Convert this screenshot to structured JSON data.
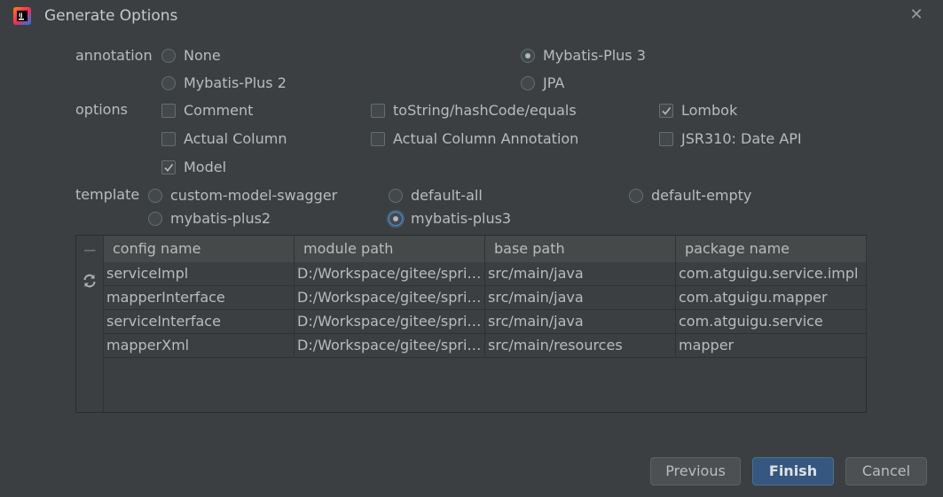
{
  "window": {
    "title": "Generate Options",
    "app_icon": "intellij-icon",
    "close_icon": "close-icon"
  },
  "annotation": {
    "label": "annotation",
    "options": [
      "None",
      "Mybatis-Plus 3",
      "Mybatis-Plus 2",
      "JPA"
    ],
    "selected": "Mybatis-Plus 3"
  },
  "options": {
    "label": "options",
    "items": [
      {
        "label": "Comment",
        "checked": false
      },
      {
        "label": "toString/hashCode/equals",
        "checked": false
      },
      {
        "label": "Lombok",
        "checked": true
      },
      {
        "label": "Actual Column",
        "checked": false
      },
      {
        "label": "Actual Column Annotation",
        "checked": false
      },
      {
        "label": "JSR310: Date API",
        "checked": false
      },
      {
        "label": "Model",
        "checked": true
      }
    ]
  },
  "template": {
    "label": "template",
    "options": [
      "custom-model-swagger",
      "default-all",
      "default-empty",
      "mybatis-plus2",
      "mybatis-plus3"
    ],
    "selected": "mybatis-plus3"
  },
  "table": {
    "toolbar": {
      "remove_icon": "minus-icon",
      "refresh_icon": "refresh-icon"
    },
    "headers": [
      "config name",
      "module path",
      "base path",
      "package name"
    ],
    "rows": [
      [
        "serviceImpl",
        "D:/Workspace/gitee/sprin...",
        "src/main/java",
        "com.atguigu.service.impl"
      ],
      [
        "mapperInterface",
        "D:/Workspace/gitee/sprin...",
        "src/main/java",
        "com.atguigu.mapper"
      ],
      [
        "serviceInterface",
        "D:/Workspace/gitee/sprin...",
        "src/main/java",
        "com.atguigu.service"
      ],
      [
        "mapperXml",
        "D:/Workspace/gitee/sprin...",
        "src/main/resources",
        "mapper"
      ]
    ]
  },
  "buttons": {
    "previous": "Previous",
    "finish": "Finish",
    "cancel": "Cancel"
  },
  "colors": {
    "background": "#3c3f41",
    "primary_button": "#365880",
    "text": "#bbbbbb"
  }
}
